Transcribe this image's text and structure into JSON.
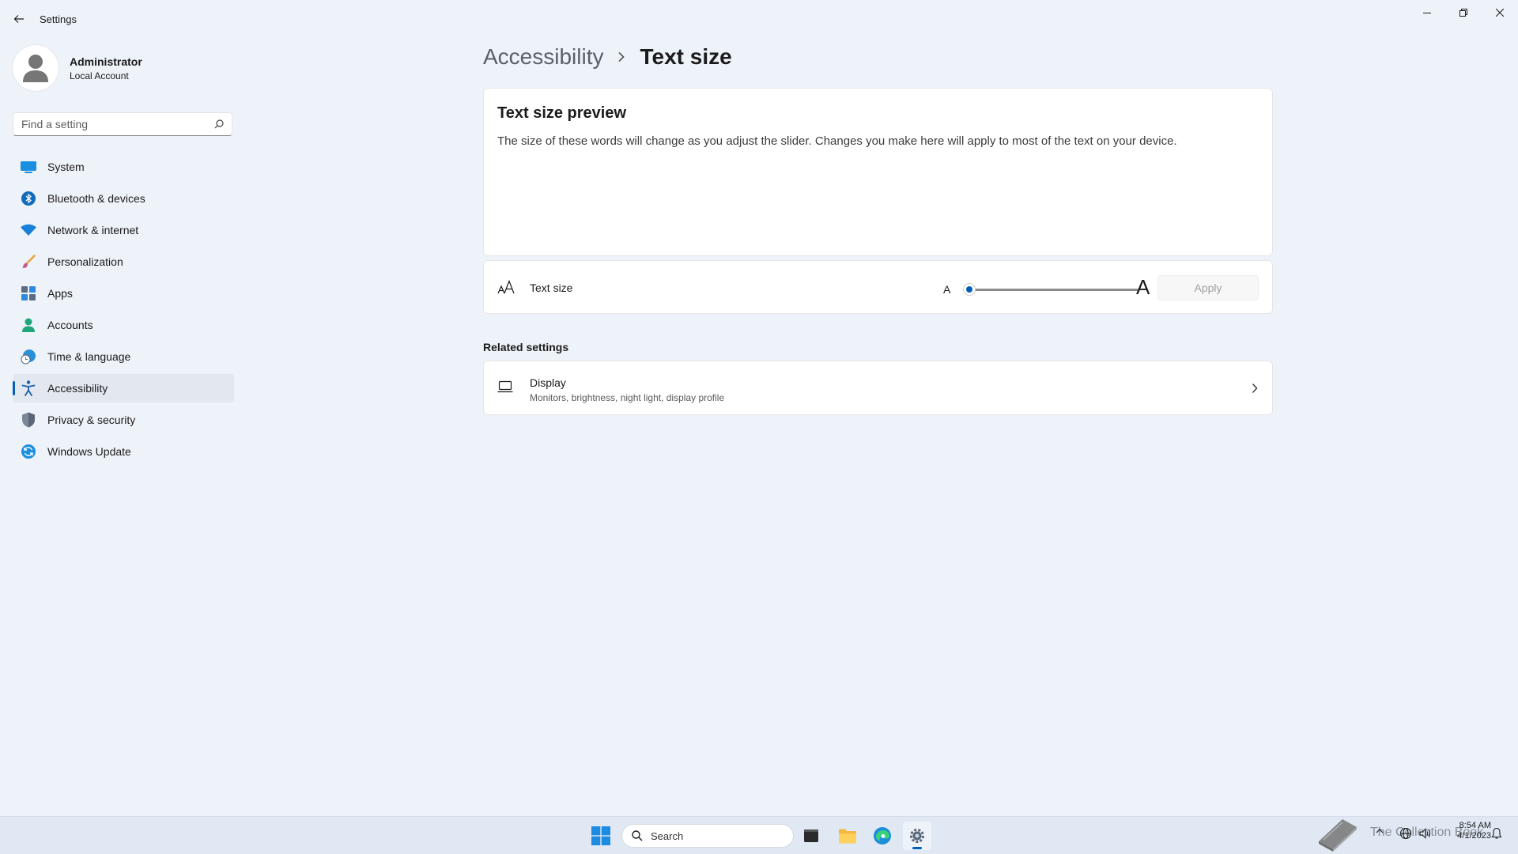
{
  "window": {
    "title": "Settings"
  },
  "profile": {
    "name": "Administrator",
    "account_type": "Local Account"
  },
  "search": {
    "placeholder": "Find a setting"
  },
  "sidebar": {
    "items": [
      {
        "label": "System",
        "icon": "system-icon"
      },
      {
        "label": "Bluetooth & devices",
        "icon": "bluetooth-icon"
      },
      {
        "label": "Network & internet",
        "icon": "wifi-icon"
      },
      {
        "label": "Personalization",
        "icon": "brush-icon"
      },
      {
        "label": "Apps",
        "icon": "apps-icon"
      },
      {
        "label": "Accounts",
        "icon": "person-icon"
      },
      {
        "label": "Time & language",
        "icon": "clock-globe-icon"
      },
      {
        "label": "Accessibility",
        "icon": "accessibility-icon",
        "active": true
      },
      {
        "label": "Privacy & security",
        "icon": "shield-icon"
      },
      {
        "label": "Windows Update",
        "icon": "update-icon"
      }
    ]
  },
  "breadcrumb": {
    "parent": "Accessibility",
    "current": "Text size"
  },
  "preview": {
    "title": "Text size preview",
    "description": "The size of these words will change as you adjust the slider. Changes you make here will apply to most of the text on your device."
  },
  "text_size": {
    "label": "Text size",
    "small_glyph": "A",
    "large_glyph": "A",
    "slider_value_fraction": 0.0,
    "apply_label": "Apply",
    "apply_enabled": false
  },
  "related": {
    "header": "Related settings",
    "display": {
      "title": "Display",
      "subtitle": "Monitors, brightness, night light, display profile"
    }
  },
  "taskbar": {
    "search_label": "Search",
    "watermark_text": "The Collection Book",
    "time": "8:54 AM",
    "date": "4/1/2023"
  },
  "colors": {
    "accent": "#005fb8",
    "background": "#eef2f9",
    "card": "#ffffff"
  }
}
